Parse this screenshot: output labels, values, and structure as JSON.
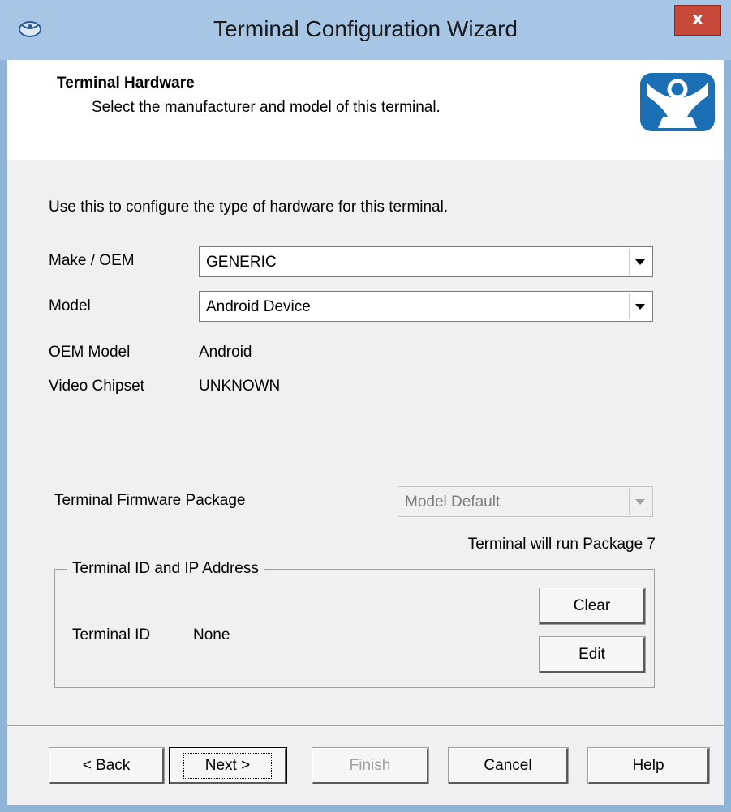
{
  "window": {
    "title": "Terminal Configuration Wizard",
    "close_label": "x"
  },
  "header": {
    "title": "Terminal Hardware",
    "subtitle": "Select the manufacturer and model of this terminal."
  },
  "main": {
    "intro": "Use this to configure the type of hardware for this terminal.",
    "make": {
      "label": "Make / OEM",
      "value": "GENERIC"
    },
    "model": {
      "label": "Model",
      "value": "Android Device"
    },
    "oem_model": {
      "label": "OEM Model",
      "value": "Android"
    },
    "video_chipset": {
      "label": "Video Chipset",
      "value": "UNKNOWN"
    },
    "firmware": {
      "label": "Terminal Firmware Package",
      "value": "Model Default",
      "note": "Terminal will run Package 7"
    },
    "terminal_group": {
      "legend": "Terminal ID and IP Address",
      "id_label": "Terminal ID",
      "id_value": "None",
      "clear_label": "Clear",
      "edit_label": "Edit"
    }
  },
  "footer": {
    "back": "< Back",
    "next": "Next >",
    "finish": "Finish",
    "cancel": "Cancel",
    "help": "Help"
  },
  "colors": {
    "titlebar": "#a7c6e6",
    "close": "#c7493a",
    "logo_blue": "#1b6fb5"
  }
}
